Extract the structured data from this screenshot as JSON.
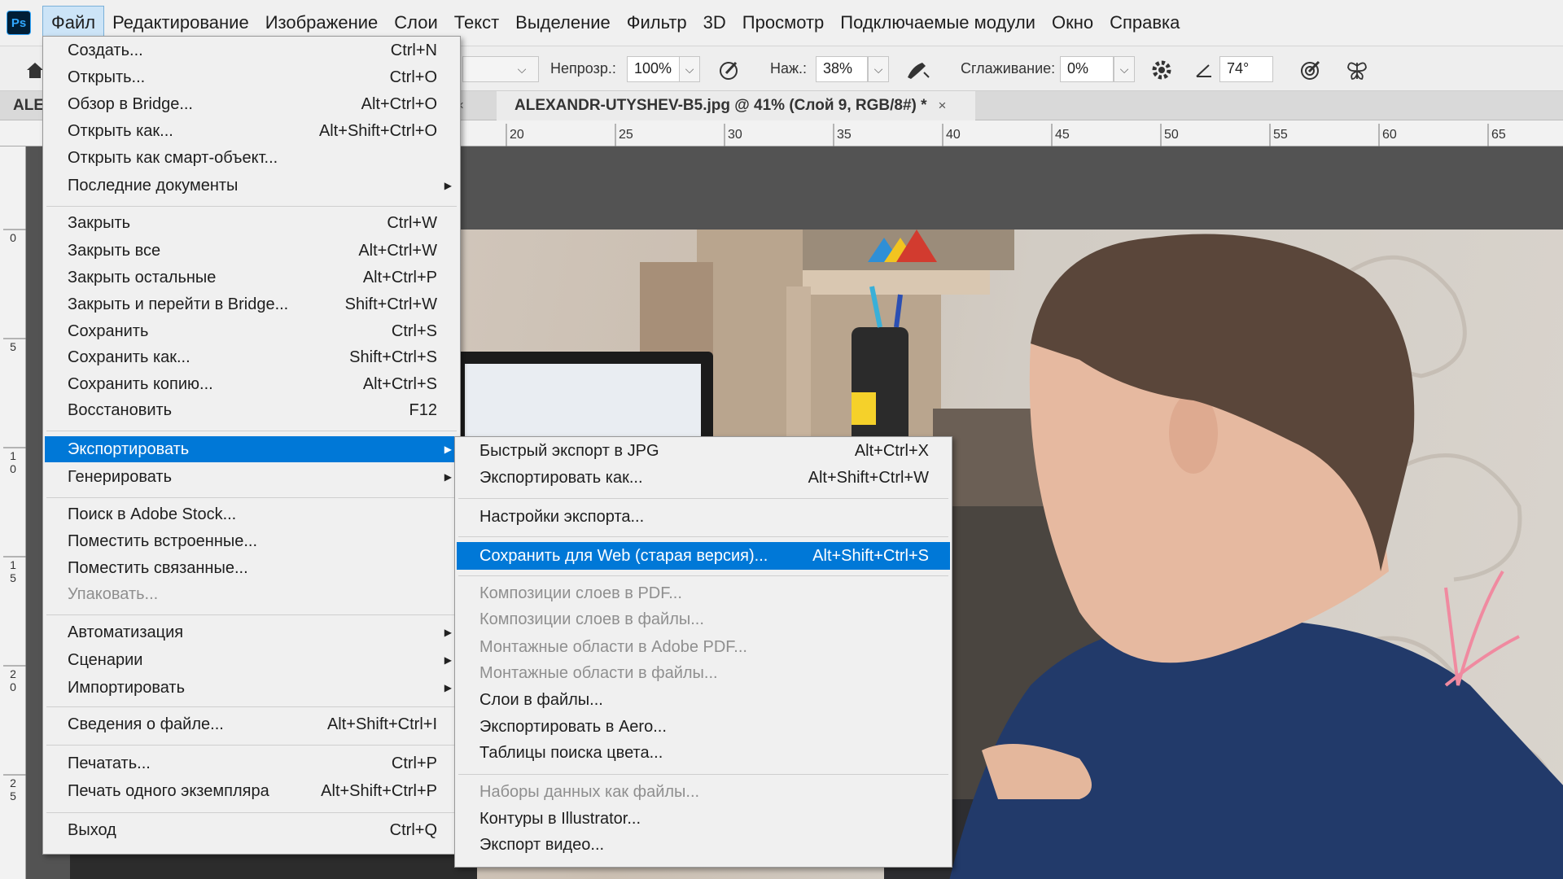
{
  "app": {
    "logo": "Ps"
  },
  "menubar": [
    "Файл",
    "Редактирование",
    "Изображение",
    "Слои",
    "Текст",
    "Выделение",
    "Фильтр",
    "3D",
    "Просмотр",
    "Подключаемые модули",
    "Окно",
    "Справка"
  ],
  "options": {
    "opacity_label": "Непрозр.:",
    "opacity_value": "100%",
    "pressure_label": "Наж.:",
    "pressure_value": "38%",
    "smoothing_label": "Сглаживание:",
    "smoothing_value": "0%",
    "angle_value": "74°"
  },
  "tabs": {
    "left_partial": "ALE",
    "active": "ALEXANDR-UTYSHEV-B5.jpg @ 41% (Слой 9, RGB/8#) *",
    "close": "×"
  },
  "ruler": {
    "h_labels": [
      "20",
      "25",
      "30",
      "35",
      "40",
      "45",
      "50",
      "55",
      "60",
      "65"
    ],
    "v_labels": [
      "0",
      "5",
      "1 0",
      "1 5",
      "2 0",
      "2 5"
    ]
  },
  "file_menu": {
    "items": [
      {
        "label": "Создать...",
        "shortcut": "Ctrl+N"
      },
      {
        "label": "Открыть...",
        "shortcut": "Ctrl+O"
      },
      {
        "label": "Обзор в Bridge...",
        "shortcut": "Alt+Ctrl+O"
      },
      {
        "label": "Открыть как...",
        "shortcut": "Alt+Shift+Ctrl+O"
      },
      {
        "label": "Открыть как смарт-объект...",
        "shortcut": ""
      },
      {
        "label": "Последние документы",
        "shortcut": "",
        "submenu": true
      },
      {
        "label": "Закрыть",
        "shortcut": "Ctrl+W"
      },
      {
        "label": "Закрыть все",
        "shortcut": "Alt+Ctrl+W"
      },
      {
        "label": "Закрыть остальные",
        "shortcut": "Alt+Ctrl+P"
      },
      {
        "label": "Закрыть и перейти в Bridge...",
        "shortcut": "Shift+Ctrl+W"
      },
      {
        "label": "Сохранить",
        "shortcut": "Ctrl+S"
      },
      {
        "label": "Сохранить как...",
        "shortcut": "Shift+Ctrl+S"
      },
      {
        "label": "Сохранить копию...",
        "shortcut": "Alt+Ctrl+S"
      },
      {
        "label": "Восстановить",
        "shortcut": "F12"
      },
      {
        "label": "Экспортировать",
        "shortcut": "",
        "submenu": true,
        "highlighted": true
      },
      {
        "label": "Генерировать",
        "shortcut": "",
        "submenu": true
      },
      {
        "label": "Поиск в Adobe Stock...",
        "shortcut": ""
      },
      {
        "label": "Поместить встроенные...",
        "shortcut": ""
      },
      {
        "label": "Поместить связанные...",
        "shortcut": ""
      },
      {
        "label": "Упаковать...",
        "shortcut": "",
        "disabled": true
      },
      {
        "label": "Автоматизация",
        "shortcut": "",
        "submenu": true
      },
      {
        "label": "Сценарии",
        "shortcut": "",
        "submenu": true
      },
      {
        "label": "Импортировать",
        "shortcut": "",
        "submenu": true
      },
      {
        "label": "Сведения о файле...",
        "shortcut": "Alt+Shift+Ctrl+I"
      },
      {
        "label": "Печатать...",
        "shortcut": "Ctrl+P"
      },
      {
        "label": "Печать одного экземпляра",
        "shortcut": "Alt+Shift+Ctrl+P"
      },
      {
        "label": "Выход",
        "shortcut": "Ctrl+Q"
      }
    ]
  },
  "export_menu": {
    "items": [
      {
        "label": "Быстрый экспорт в JPG",
        "shortcut": "Alt+Ctrl+X"
      },
      {
        "label": "Экспортировать как...",
        "shortcut": "Alt+Shift+Ctrl+W"
      },
      {
        "label": "Настройки экспорта...",
        "shortcut": ""
      },
      {
        "label": "Сохранить для Web (старая версия)...",
        "shortcut": "Alt+Shift+Ctrl+S",
        "highlighted": true
      },
      {
        "label": "Композиции слоев в PDF...",
        "shortcut": "",
        "disabled": true
      },
      {
        "label": "Композиции слоев в файлы...",
        "shortcut": "",
        "disabled": true
      },
      {
        "label": "Монтажные области в Adobe PDF...",
        "shortcut": "",
        "disabled": true
      },
      {
        "label": "Монтажные области в файлы...",
        "shortcut": "",
        "disabled": true
      },
      {
        "label": "Слои в файлы...",
        "shortcut": ""
      },
      {
        "label": "Экспортировать в Aero...",
        "shortcut": ""
      },
      {
        "label": "Таблицы поиска цвета...",
        "shortcut": ""
      },
      {
        "label": "Наборы данных как файлы...",
        "shortcut": "",
        "disabled": true
      },
      {
        "label": "Контуры в Illustrator...",
        "shortcut": ""
      },
      {
        "label": "Экспорт видео...",
        "shortcut": ""
      }
    ]
  },
  "colors": {
    "highlight": "#0078d7",
    "menu_bg": "#f0f0f0",
    "workspace": "#535353"
  }
}
